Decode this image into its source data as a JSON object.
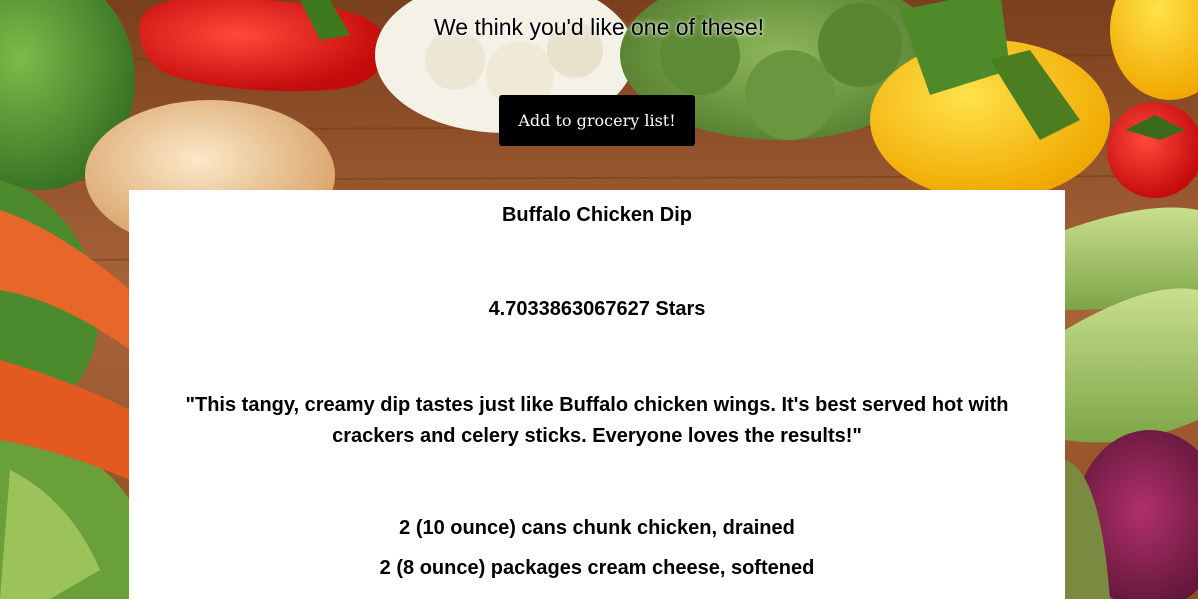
{
  "header": {
    "headline": "We think you'd like one of these!",
    "add_button_label": "Add to grocery list!"
  },
  "recipe": {
    "title": "Buffalo Chicken Dip",
    "rating_text": "4.7033863067627 Stars",
    "description": "\"This tangy, creamy dip tastes just like Buffalo chicken wings. It's best served hot with crackers and celery sticks. Everyone loves the results!\"",
    "ingredients": [
      "2 (10 ounce) cans chunk chicken, drained",
      "2 (8 ounce) packages cream cheese, softened"
    ]
  },
  "colors": {
    "button_bg": "#000000",
    "card_bg": "#ffffff",
    "table_wood": "#9a5a2c"
  },
  "background": {
    "description_icon": "vegetables-photo"
  }
}
